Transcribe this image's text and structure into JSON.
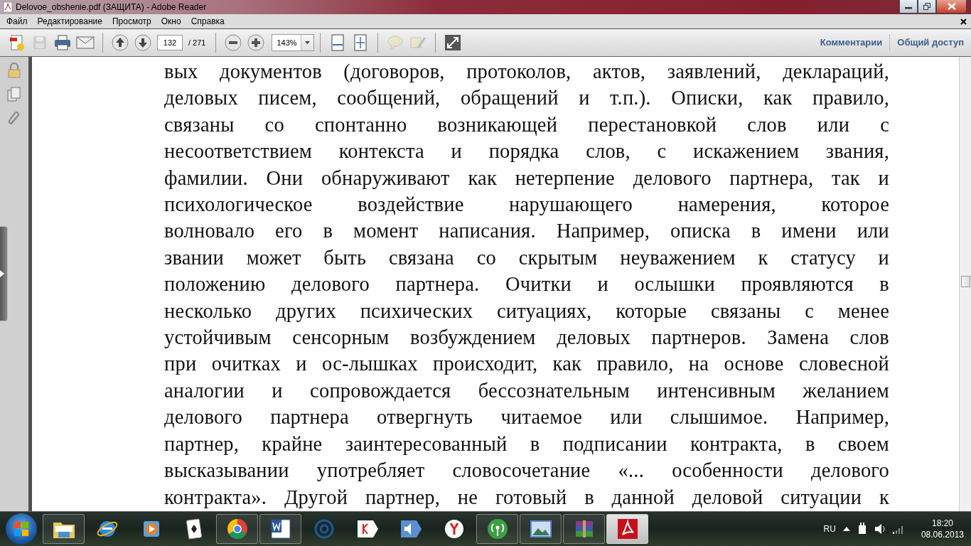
{
  "window": {
    "title": "Delovoe_obshenie.pdf (ЗАЩИТА) - Adobe Reader"
  },
  "menu": [
    "Файл",
    "Редактирование",
    "Просмотр",
    "Окно",
    "Справка"
  ],
  "toolbar": {
    "buttons": [
      {
        "kind": "create",
        "disabled": false
      },
      {
        "kind": "save",
        "disabled": true
      },
      {
        "kind": "print",
        "disabled": false
      },
      {
        "kind": "email",
        "disabled": false
      },
      {
        "kind": "sep"
      },
      {
        "kind": "page-up",
        "disabled": false
      },
      {
        "kind": "page-down",
        "disabled": false
      },
      {
        "kind": "page-field"
      },
      {
        "kind": "sep"
      },
      {
        "kind": "zoom-out",
        "disabled": false
      },
      {
        "kind": "zoom-in",
        "disabled": false
      },
      {
        "kind": "zoom-field"
      },
      {
        "kind": "sep"
      },
      {
        "kind": "fit-width",
        "disabled": false
      },
      {
        "kind": "fit-page",
        "disabled": false
      },
      {
        "kind": "sep"
      },
      {
        "kind": "comment",
        "disabled": true
      },
      {
        "kind": "highlight",
        "disabled": true
      },
      {
        "kind": "sep"
      },
      {
        "kind": "fullscreen",
        "disabled": false
      }
    ],
    "page": "132",
    "page_count": "/ 271",
    "zoom": "143%",
    "links": [
      "Комментарии",
      "Общий доступ"
    ]
  },
  "document": {
    "lines": [
      "вых документов (договоров, протоколов, актов, заявлений, деклараций,",
      "деловых писем, сообщений, обращений и т.п.). Описки, как правило,",
      "связаны со спонтанно возникающей перестановкой слов или с",
      "несоответствием контекста и порядка слов, с искажением звания,",
      "фамилии. Они обнаруживают как нетерпение делового партнера, так и",
      "психологическое воздействие нарушающего намерения, которое",
      "волновало его в момент написания. Например, описка в имени или",
      "звании может быть связана со скрытым неуважением к статусу и",
      "положению делового партнера. Очитки и ослышки проявляются в",
      "несколько других психических ситуациях, которые связаны с менее",
      "устойчивым сенсорным возбуждением деловых партнеров. Замена слов",
      "при очитках и ос-лышках происходит, как правило, на основе словесной",
      "аналогии и сопровождается бессознательным интенсивным желанием",
      "делового партнера отвергнуть читаемое или слышимое. Например,",
      "партнер, крайне заинтересованный в подписании контракта, в своем",
      "высказывании употребляет словосочетание «... особенности делового",
      "контракта». Другой партнер, не готовый в данной деловой ситуации к"
    ]
  },
  "taskbar": {
    "apps": [
      {
        "kind": "folder",
        "running": true,
        "selected": false
      },
      {
        "kind": "browser-e",
        "running": false,
        "selected": false
      },
      {
        "kind": "media",
        "running": false,
        "selected": false
      },
      {
        "kind": "cards",
        "running": false,
        "selected": false
      },
      {
        "kind": "chrome",
        "running": true,
        "selected": false
      },
      {
        "kind": "word",
        "running": true,
        "selected": false
      },
      {
        "kind": "mail",
        "running": false,
        "selected": false
      },
      {
        "kind": "yandex",
        "running": false,
        "selected": false
      },
      {
        "kind": "speaker",
        "running": false,
        "selected": false
      },
      {
        "kind": "yabrowser",
        "running": false,
        "selected": false
      },
      {
        "kind": "antenna",
        "running": true,
        "selected": false
      },
      {
        "kind": "photo",
        "running": true,
        "selected": false
      },
      {
        "kind": "archive",
        "running": true,
        "selected": false
      },
      {
        "kind": "pdf",
        "running": true,
        "selected": true
      }
    ],
    "language": "RU",
    "time": "18:20",
    "date": "08.06.2013"
  }
}
